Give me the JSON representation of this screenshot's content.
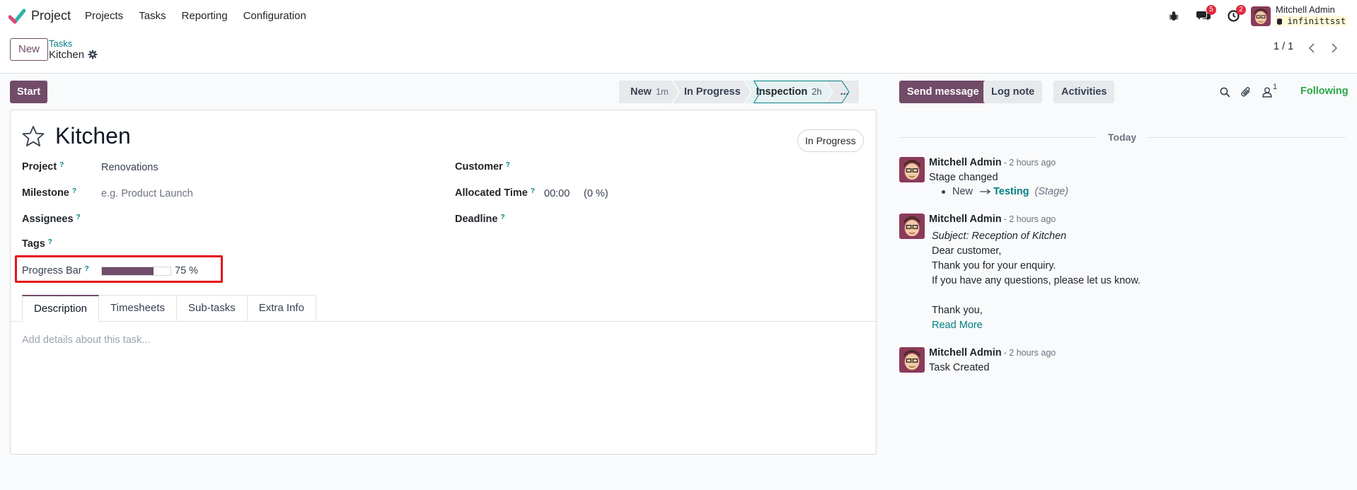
{
  "navbar": {
    "app_name": "Project",
    "menu": [
      "Projects",
      "Tasks",
      "Reporting",
      "Configuration"
    ],
    "chat_badge": "5",
    "activity_badge": "2",
    "user_name": "Mitchell Admin",
    "database": "infinittsst"
  },
  "control_panel": {
    "new_label": "New",
    "breadcrumb_parent": "Tasks",
    "breadcrumb_current": "Kitchen",
    "pager": "1 / 1"
  },
  "statusbar": {
    "start_label": "Start",
    "stages": [
      {
        "name": "New",
        "duration": "1m"
      },
      {
        "name": "In Progress",
        "duration": ""
      },
      {
        "name": "Inspection",
        "duration": "2h"
      }
    ],
    "more_label": "..."
  },
  "form": {
    "title": "Kitchen",
    "state": "In Progress",
    "help_mark": "?",
    "labels": {
      "project": "Project",
      "milestone": "Milestone",
      "assignees": "Assignees",
      "tags": "Tags",
      "customer": "Customer",
      "allocated_time": "Allocated Time",
      "deadline": "Deadline",
      "progress_bar": "Progress Bar"
    },
    "values": {
      "project": "Renovations",
      "milestone_placeholder": "e.g. Product Launch",
      "allocated_time": "00:00",
      "allocated_percent": "(0 %)",
      "progress_text": "75 %",
      "progress_percent": 75
    },
    "tabs": [
      "Description",
      "Timesheets",
      "Sub-tasks",
      "Extra Info"
    ],
    "description_placeholder": "Add details about this task..."
  },
  "chatter": {
    "send_message": "Send message",
    "log_note": "Log note",
    "activities": "Activities",
    "follower_count": "1",
    "following": "Following",
    "today": "Today",
    "messages": [
      {
        "author": "Mitchell Admin",
        "date": "- 2 hours ago",
        "text": "Stage changed",
        "tracking_old": "New",
        "tracking_new": "Testing",
        "tracking_field": "(Stage)"
      },
      {
        "author": "Mitchell Admin",
        "date": "- 2 hours ago",
        "subject": "Subject: Reception of Kitchen",
        "lines": [
          "Dear customer,",
          "Thank you for your enquiry.",
          "If you have any questions, please let us know.",
          "Thank you,"
        ],
        "read_more": "Read More"
      },
      {
        "author": "Mitchell Admin",
        "date": "- 2 hours ago",
        "text": "Task Created"
      }
    ]
  },
  "colors": {
    "brand": "#714b67",
    "link": "#017e84",
    "following": "#28a745",
    "highlight": "#e5141a"
  }
}
